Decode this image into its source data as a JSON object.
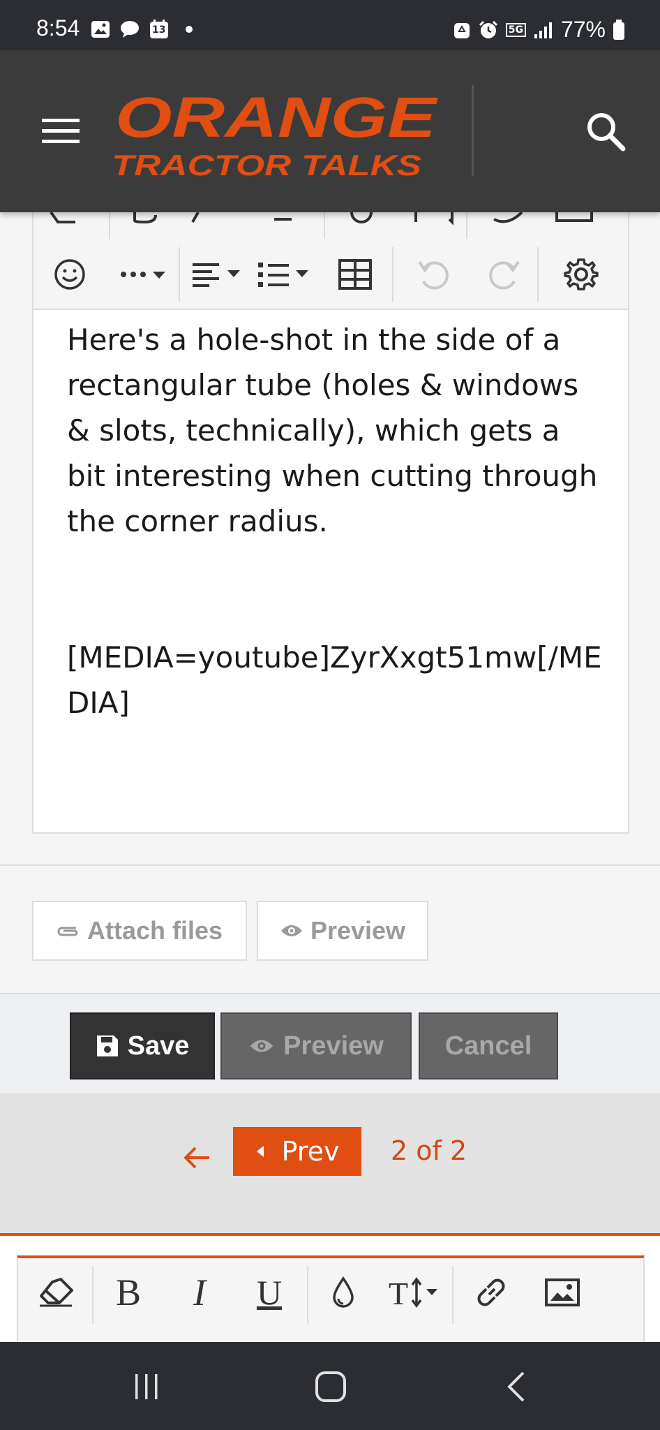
{
  "status_bar": {
    "time": "8:54",
    "calendar_day": "13",
    "network": "5G",
    "battery": "77%"
  },
  "header": {
    "logo_line1": "ORANGE",
    "logo_line2": "TRACTOR TALKS",
    "brand_color": "#e04e12"
  },
  "editor": {
    "paragraph": "Here's a hole-shot in the side of a rectangular tube (holes & windows & slots, technically), which gets a bit interesting when cutting through the corner radius.",
    "media_tag": "[MEDIA=youtube]ZyrXxgt51mw[/MEDIA]",
    "toolbar_icons": [
      "smile-icon",
      "more-icon",
      "align-icon",
      "list-icon",
      "table-icon",
      "undo-icon",
      "redo-icon",
      "gear-icon"
    ]
  },
  "attach": {
    "attach_label": "Attach files",
    "preview_label": "Preview"
  },
  "actions": {
    "save_label": "Save",
    "preview_label": "Preview",
    "cancel_label": "Cancel"
  },
  "pagination": {
    "prev_label": "Prev",
    "page_indicator": "2 of 2"
  },
  "bottom_toolbar": {
    "icons": [
      "eraser-icon",
      "bold-icon",
      "italic-icon",
      "underline-icon",
      "color-icon",
      "text-size-icon",
      "link-icon",
      "image-icon"
    ]
  },
  "colors": {
    "accent": "#e04e12",
    "header_bg": "#3b3b3b",
    "system_bar": "#2b2d33"
  }
}
